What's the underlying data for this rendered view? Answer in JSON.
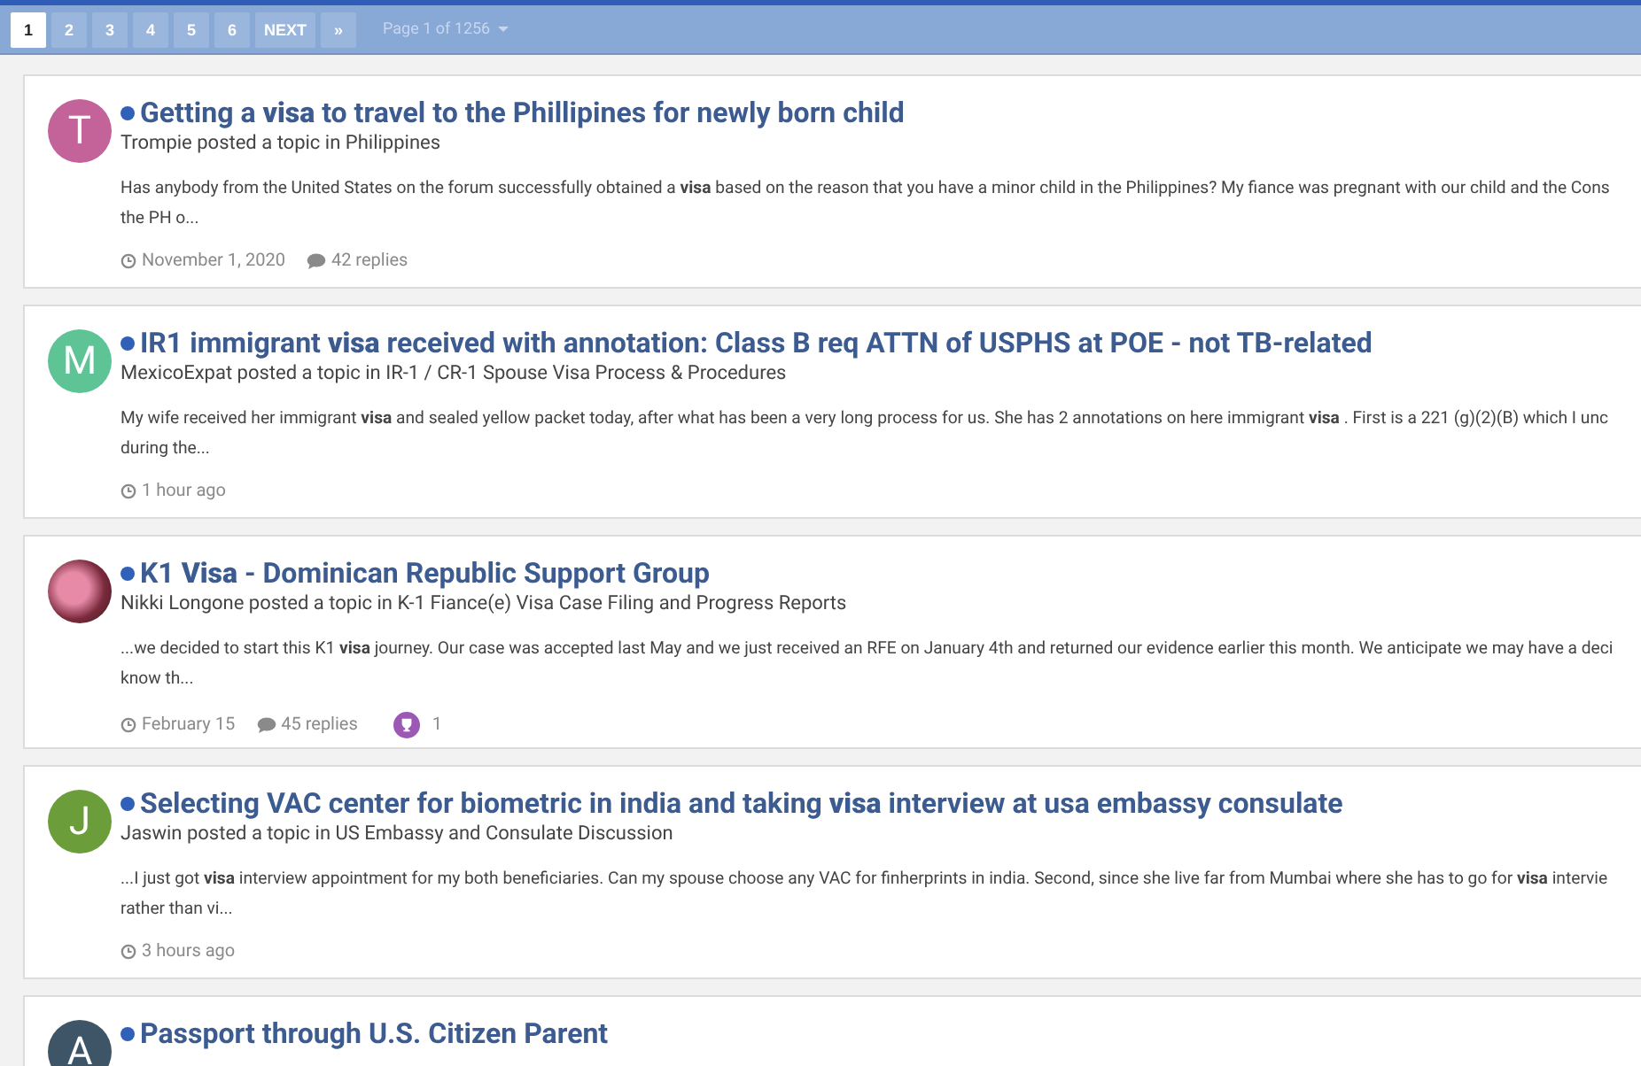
{
  "pagination": {
    "pages": [
      {
        "label": "1",
        "selected": true
      },
      {
        "label": "2",
        "selected": false
      },
      {
        "label": "3",
        "selected": false
      },
      {
        "label": "4",
        "selected": false
      },
      {
        "label": "5",
        "selected": false
      },
      {
        "label": "6",
        "selected": false
      }
    ],
    "next": "NEXT",
    "last": "»",
    "page_info": "Page 1 of 1256"
  },
  "results": [
    {
      "avatar": {
        "kind": "letter",
        "letter": "T",
        "color": "#c4639a"
      },
      "unread": true,
      "title": "Getting a **visa** to travel to the Phillipines for newly born child",
      "meta": "Trompie posted a topic in Philippines",
      "excerpt": [
        "Has anybody from the United States on the forum successfully obtained a **visa** based on the reason that you have a minor child in the Philippines? My fiance was pregnant with our child and the Cons",
        "the PH o..."
      ],
      "date": "November 1, 2020",
      "replies": "42 replies"
    },
    {
      "avatar": {
        "kind": "letter",
        "letter": "M",
        "color": "#5ec496"
      },
      "unread": true,
      "title": "IR1 immigrant **visa** received with annotation: Class B req ATTN of USPHS at POE - not TB-related",
      "meta": "MexicoExpat posted a topic in IR-1 / CR-1 Spouse Visa Process & Procedures",
      "excerpt": [
        "My wife received her immigrant **visa** and sealed yellow packet today, after what has been a very long process for us. She has 2 annotations on here immigrant **visa** . First is a 221 (g)(2)(B) which I unc",
        "during the..."
      ],
      "date": "1 hour ago"
    },
    {
      "avatar": {
        "kind": "photo"
      },
      "unread": true,
      "title": "K1 **Visa** - Dominican Republic Support Group",
      "meta": "Nikki Longone posted a topic in K-1 Fiance(e) Visa Case Filing and Progress Reports",
      "excerpt": [
        "...we decided to start this K1 **visa** journey. Our case was accepted last May and we just received an RFE on January 4th and returned our evidence earlier this month. We anticipate we may have a deci",
        "know th..."
      ],
      "date": "February 15",
      "replies": "45 replies",
      "reactions": "1"
    },
    {
      "avatar": {
        "kind": "letter",
        "letter": "J",
        "color": "#6b9e3a"
      },
      "unread": true,
      "title": "Selecting VAC center for biometric in india and taking **visa** interview at usa embassy consulate",
      "meta": "Jaswin posted a topic in US Embassy and Consulate Discussion",
      "excerpt": [
        "...I just got **visa** interview appointment for my both beneficiaries. Can my spouse choose any VAC for finherprints in india. Second, since she live far from Mumbai where she has to go for **visa** intervie",
        "rather than vi..."
      ],
      "date": "3 hours ago"
    },
    {
      "avatar": {
        "kind": "letter",
        "letter": "A",
        "color": "#3d5566"
      },
      "unread": true,
      "title": "Passport through U.S. Citizen Parent"
    }
  ]
}
